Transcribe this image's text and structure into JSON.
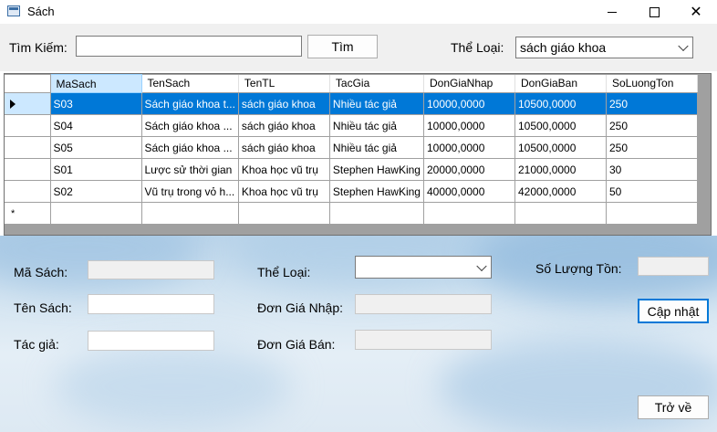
{
  "window": {
    "title": "Sách"
  },
  "search": {
    "label": "Tìm Kiếm:",
    "value": "",
    "button": "Tìm"
  },
  "category_filter": {
    "label": "Thể Loại:",
    "selected": "sách giáo khoa"
  },
  "grid": {
    "columns": [
      "MaSach",
      "TenSach",
      "TenTL",
      "TacGia",
      "DonGiaNhap",
      "DonGiaBan",
      "SoLuongTon"
    ],
    "rows": [
      [
        "S03",
        "Sách giáo khoa t...",
        "sách giáo khoa",
        "Nhiều tác giả",
        "10000,0000",
        "10500,0000",
        "250"
      ],
      [
        "S04",
        "Sách giáo khoa ...",
        "sách giáo khoa",
        "Nhiều tác giả",
        "10000,0000",
        "10500,0000",
        "250"
      ],
      [
        "S05",
        "Sách giáo khoa ...",
        "sách giáo khoa",
        "Nhiều tác giả",
        "10000,0000",
        "10500,0000",
        "250"
      ],
      [
        "S01",
        "Lược sử thời gian",
        "Khoa học vũ trụ",
        "Stephen HawKing",
        "20000,0000",
        "21000,0000",
        "30"
      ],
      [
        "S02",
        "Vũ trụ trong vỏ h...",
        "Khoa học vũ trụ",
        "Stephen HawKing",
        "40000,0000",
        "42000,0000",
        "50"
      ]
    ],
    "new_row_marker": "*"
  },
  "form": {
    "ma_sach_label": "Mã Sách:",
    "ten_sach_label": "Tên Sách:",
    "tac_gia_label": "Tác giả:",
    "the_loai_label": "Thể Loại:",
    "don_gia_nhap_label": "Đơn Giá Nhập:",
    "don_gia_ban_label": "Đơn Giá Bán:",
    "so_luong_ton_label": "Số Lượng Tồn:",
    "update_button": "Cập nhật",
    "back_button": "Trở về"
  }
}
